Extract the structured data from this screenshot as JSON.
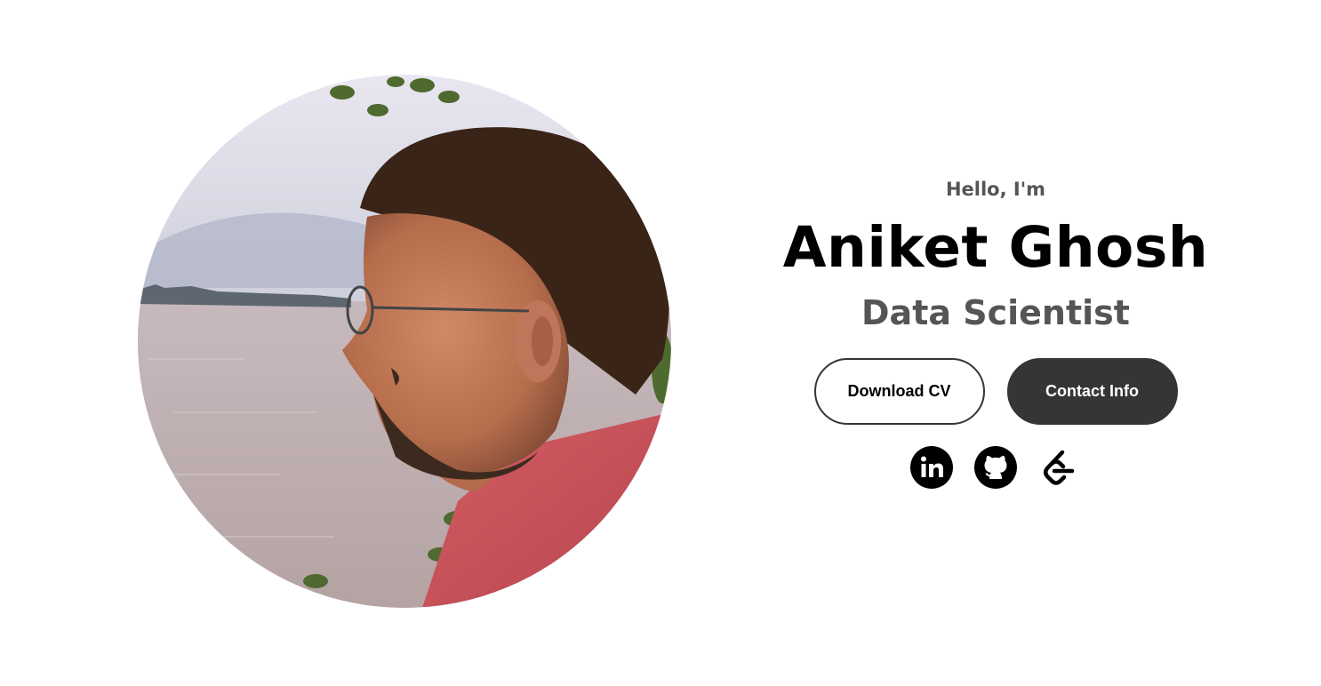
{
  "profile": {
    "photo": "portrait-photo"
  },
  "intro": {
    "greeting": "Hello, I'm",
    "name": "Aniket Ghosh",
    "role": "Data Scientist"
  },
  "buttons": {
    "download_cv": "Download CV",
    "contact_info": "Contact Info"
  },
  "socials": [
    {
      "icon": "linkedin-icon"
    },
    {
      "icon": "github-icon"
    },
    {
      "icon": "leetcode-icon"
    }
  ],
  "colors": {
    "text_primary": "#000000",
    "text_secondary": "#555555",
    "button_dark": "#353535",
    "background": "#ffffff"
  }
}
